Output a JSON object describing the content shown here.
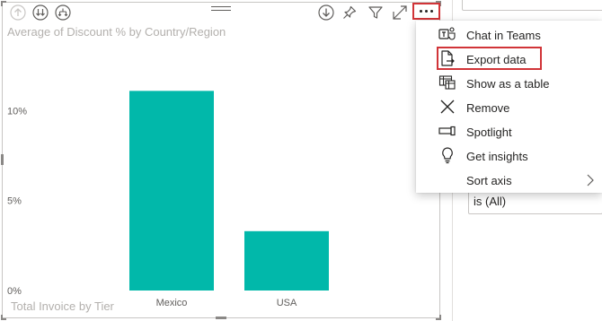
{
  "visual": {
    "title": "Average of Discount % by Country/Region",
    "footer": "Total Invoice by Tier",
    "header_icons": [
      "drill-up-icon",
      "drill-down-next-level-icon",
      "expand-hierarchy-icon",
      "drill-down-mode-icon",
      "pin-icon",
      "filter-icon",
      "focus-mode-icon",
      "more-options-icon"
    ]
  },
  "chart_data": {
    "type": "bar",
    "title": "Average of Discount % by Country/Region",
    "categories": [
      "Mexico",
      "USA"
    ],
    "values": [
      11.1,
      3.3
    ],
    "unit": "%",
    "ylim": [
      0,
      13.76
    ],
    "yticks": [
      0,
      5,
      10
    ],
    "ytick_labels": [
      "0%",
      "5%",
      "10%"
    ],
    "color": "#01b8aa",
    "grid": false
  },
  "menu": {
    "items": [
      {
        "label": "Chat in Teams",
        "icon": "teams-icon"
      },
      {
        "label": "Export data",
        "icon": "export-data-icon"
      },
      {
        "label": "Show as a table",
        "icon": "show-table-icon"
      },
      {
        "label": "Remove",
        "icon": "remove-icon"
      },
      {
        "label": "Spotlight",
        "icon": "spotlight-icon"
      },
      {
        "label": "Get insights",
        "icon": "lightbulb-icon"
      },
      {
        "label": "Sort axis",
        "icon": "",
        "has_submenu": true
      }
    ]
  },
  "right_pane": {
    "filter_value": "is (All)"
  },
  "colors": {
    "bar": "#01b8aa",
    "highlight": "#d13438",
    "muted_text": "#b3b0ad"
  }
}
